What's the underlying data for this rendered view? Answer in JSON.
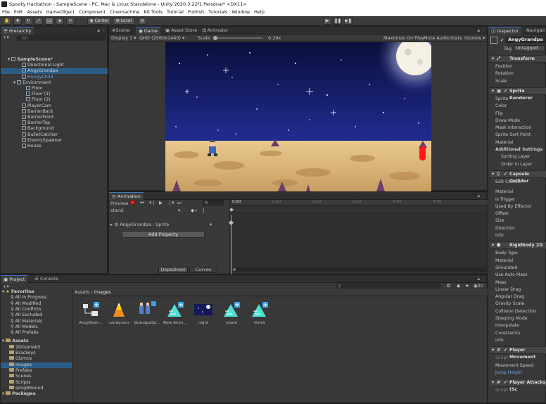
{
  "window": {
    "title": "Spooky Hackathon - SampleScene - PC, Mac & Linux Standalone - Unity 2020.3.22f1 Personal* <DX11>"
  },
  "menu": [
    "File",
    "Edit",
    "Assets",
    "GameObject",
    "Component",
    "Cinemachine",
    "Kit Tools",
    "Tutorial",
    "Publish",
    "Tutorials",
    "Window",
    "Help"
  ],
  "toolbar": {
    "center": "Center",
    "local": "Local"
  },
  "hierarchy": {
    "tab": "Hierarchy",
    "search_placeholder": "All",
    "items": [
      {
        "label": "SampleScene*"
      },
      {
        "label": "Directional Light"
      },
      {
        "label": "AngyGrandpa"
      },
      {
        "label": "HungyChild"
      },
      {
        "label": "Enviornment"
      },
      {
        "label": "Floor"
      },
      {
        "label": "Floor (1)"
      },
      {
        "label": "Floor (2)"
      },
      {
        "label": "PlayerCam"
      },
      {
        "label": "BarrierBack"
      },
      {
        "label": "BarrierFront"
      },
      {
        "label": "BarrierTop"
      },
      {
        "label": "Background"
      },
      {
        "label": "BulletCatcher"
      },
      {
        "label": "EnemySpawner"
      },
      {
        "label": "House"
      }
    ]
  },
  "center": {
    "tabs": [
      "Scene",
      "Game",
      "Asset Store",
      "Animator"
    ],
    "display": "Display 1",
    "resolution": "QHD (2560x1440)",
    "scale_label": "Scale",
    "scale_value": "0.29x",
    "options": [
      "Maximize On Play",
      "Mute Audio",
      "Stats",
      "Gizmos"
    ]
  },
  "animation": {
    "tab": "Animation",
    "preview": "Preview",
    "frame": "0",
    "clip": "stand",
    "property": "AngyGrandpa : Sprite",
    "add_property": "Add Property",
    "dopesheet": "Dopesheet",
    "curves": "Curves",
    "timeline": [
      "0:00",
      "0:10",
      "0:20",
      "0:30",
      "0:40",
      "0:50"
    ]
  },
  "project": {
    "tabs": [
      "Project",
      "Console"
    ],
    "favorites_label": "Favorites",
    "favorites": [
      "All In Progress",
      "All Modified",
      "All Conflicts",
      "All Excluded",
      "All Materials",
      "All Models",
      "All Prefabs"
    ],
    "assets_label": "Assets",
    "assets": [
      "2DGamekit",
      "Brackeys",
      "Gizmos",
      "Images",
      "Prefabs",
      "Scenes",
      "Scripts",
      "songNSound"
    ],
    "packages_label": "Packages",
    "breadcrumb_root": "Assets",
    "breadcrumb_current": "Images",
    "count": "20",
    "files": [
      "AngyGran...",
      "candycorn",
      "GrandpaSp...",
      "New Anim...",
      "night",
      "stand",
      "throw"
    ]
  },
  "inspector": {
    "tabs": [
      "Inspector",
      "Navigation"
    ],
    "object_name": "AngyGrandpa",
    "tag_label": "Tag",
    "tag_value": "Untagged",
    "transform": {
      "title": "Transform",
      "fields": [
        "Position",
        "Rotation",
        "Scale"
      ]
    },
    "sprite_renderer": {
      "title": "Sprite Renderer",
      "fields": [
        "Sprite",
        "Color",
        "Flip",
        "Draw Mode",
        "Mask Interaction",
        "Sprite Sort Point",
        "Material"
      ],
      "additional": "Additional Settings",
      "sub": [
        "Sorting Layer",
        "Order in Layer"
      ]
    },
    "capsule": {
      "title": "Capsule Collider",
      "edit": "Edit Collider",
      "fields": [
        "Material",
        "Is Trigger",
        "Used By Effector",
        "Offset",
        "Size",
        "Direction",
        "Info"
      ]
    },
    "rigidbody": {
      "title": "Rigidbody 2D",
      "fields": [
        "Body Type",
        "Material",
        "Simulated",
        "Use Auto Mass",
        "Mass",
        "Linear Drag",
        "Angular Drag",
        "Gravity Scale",
        "Collision Detection",
        "Sleeping Mode",
        "Interpolate",
        "Constraints",
        "Info"
      ]
    },
    "player_movement": {
      "title": "Player Movement",
      "fields": [
        "Script",
        "Movement Speed",
        "Jump Height"
      ]
    },
    "player_attacks": {
      "title": "Player Attacks (Sc",
      "fields": [
        "Script"
      ]
    }
  }
}
